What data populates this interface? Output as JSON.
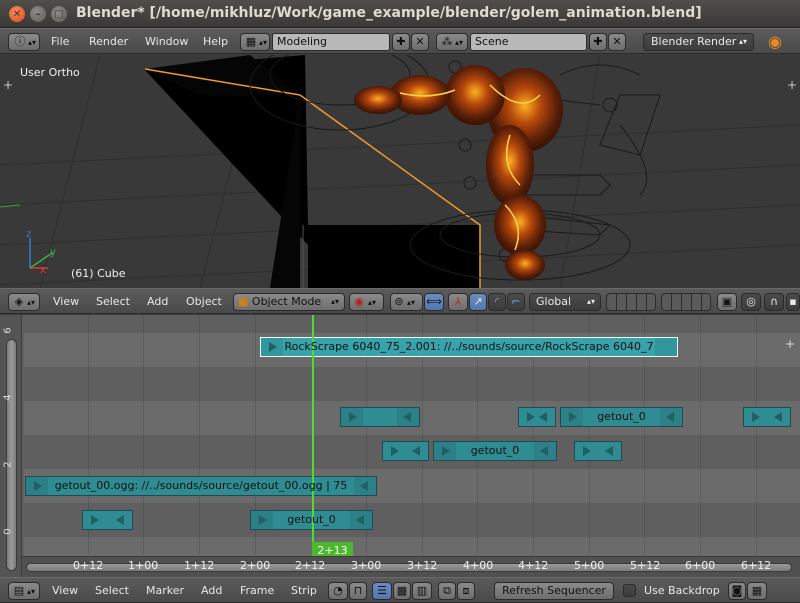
{
  "window": {
    "title": "Blender* [/home/mikhluz/Work/game_example/blender/golem_animation.blend]"
  },
  "info_header": {
    "menus": [
      "File",
      "Render",
      "Window",
      "Help"
    ],
    "screen_layout": "Modeling",
    "scene": "Scene",
    "render_engine": "Blender Render"
  },
  "viewport": {
    "view_label": "User Ortho",
    "object_label": "(61) Cube"
  },
  "view3d_header": {
    "menus": [
      "View",
      "Select",
      "Add",
      "Object"
    ],
    "mode": "Object Mode",
    "orientation": "Global"
  },
  "sequencer": {
    "channel_labels": [
      "6",
      "4",
      "2",
      "0"
    ],
    "frame_ticks": [
      "0+12",
      "1+00",
      "1+12",
      "2+00",
      "2+12",
      "3+00",
      "3+12",
      "4+00",
      "4+12",
      "5+00",
      "5+12",
      "6+00",
      "6+12"
    ],
    "current_frame": "2+13",
    "strips": {
      "rockscrape": "RockScrape 6040_75_2.001: //../sounds/source/RockScrape 6040_7",
      "getout_a": "getout_0",
      "getout_b": "getout_0",
      "getout_sound": "getout_00.ogg: //../sounds/source/getout_00.ogg | 75",
      "getout_c": "getout_0"
    }
  },
  "seq_header": {
    "menus": [
      "View",
      "Select",
      "Marker",
      "Add",
      "Frame",
      "Strip"
    ],
    "refresh_label": "Refresh Sequencer",
    "backdrop_label": "Use Backdrop"
  },
  "colors": {
    "strip_sound": "#2f8c93",
    "playhead": "#4cdc32",
    "viewport_bg": "#393939"
  }
}
